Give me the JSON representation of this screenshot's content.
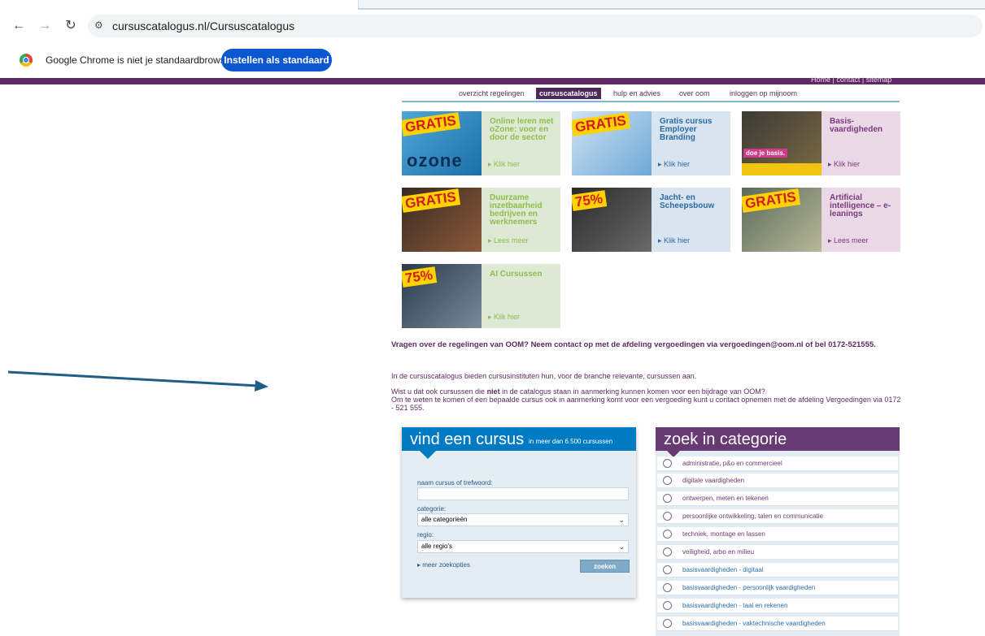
{
  "browser": {
    "url": "cursuscatalogus.nl/Cursuscatalogus",
    "info_message": "Google Chrome is niet je standaardbrowser",
    "set_default_button": "Instellen als standaard"
  },
  "site": {
    "top_links": "Home | contact | sitemap",
    "nav": [
      "overzicht regelingen",
      "cursuscatalogus",
      "hulp en advies",
      "over oom",
      "inloggen op mijnoom"
    ]
  },
  "cards": [
    {
      "badge": "GRATIS",
      "title": "Online leren met oZone: voor en door de sector",
      "link": "Klik hier",
      "image_text": "ozone"
    },
    {
      "badge": "GRATIS",
      "title": "Gratis cursus Employer Branding",
      "link": "Klik hier"
    },
    {
      "title": "Basis-vaardigheden",
      "link": "Klik hier",
      "image_text": "doe je basis."
    },
    {
      "badge": "GRATIS",
      "title": "Duurzame inzetbaarheid bedrijven en werknemers",
      "link": "Lees meer"
    },
    {
      "badge": "75%",
      "title": "Jacht- en Scheepsbouw",
      "link": "Klik hier"
    },
    {
      "badge": "GRATIS",
      "title": "Artificial intelligence – e-leanings",
      "link": "Lees meer"
    },
    {
      "badge": "75%",
      "title": "AI Cursussen",
      "link": "Klik hier"
    }
  ],
  "info": {
    "question": "Vragen over de regelingen van OOM? Neem contact op met de afdeling vergoedingen via vergoedingen@oom.nl of bel 0172-521555.",
    "intro": "In de cursuscatalogus bieden cursusinstituten hun, voor de branche relevante, cursussen aan.",
    "line1_pre": "Wist u dat ook cursussen die ",
    "line1_bold": "niet",
    "line1_post": " in de catalogus staan in aanmerking kunnen komen voor een bijdrage van OOM?",
    "line2": "Om te weten te komen of een bepaalde cursus ook in aanmerking komt voor een vergoeding kunt u contact opnemen met de afdeling Vergoedingen via 0172 - 521 555."
  },
  "search": {
    "title": "vind een cursus",
    "subtitle": "in meer dan 6.500 cursussen",
    "name_label": "naam cursus of trefwoord:",
    "name_value": "",
    "category_label": "categorie:",
    "category_value": "alle categorieën",
    "region_label": "regio:",
    "region_value": "alle regio's",
    "more_options": "meer zoekopties",
    "submit": "zoeken"
  },
  "categories": {
    "title": "zoek in categorie",
    "items": [
      "administratie, p&o en commercieel",
      "digitale vaardigheden",
      "ontwerpen, meten en tekenen",
      "persoonlijke ontwikkeling, talen en communicatie",
      "techniek, montage en lassen",
      "veiligheid, arbo en milieu",
      "basisvaardigheden - digitaal",
      "basisvaardigheden - persoonlijk vaardigheden",
      "basisvaardigheden - taal en rekenen",
      "basisvaardigheden - vaktechnische vaardigheden"
    ]
  },
  "colors": {
    "purple": "#5e2a63",
    "blue": "#007bc3",
    "chrome_button": "#0b57d0",
    "arrow": "#1f5f86"
  }
}
